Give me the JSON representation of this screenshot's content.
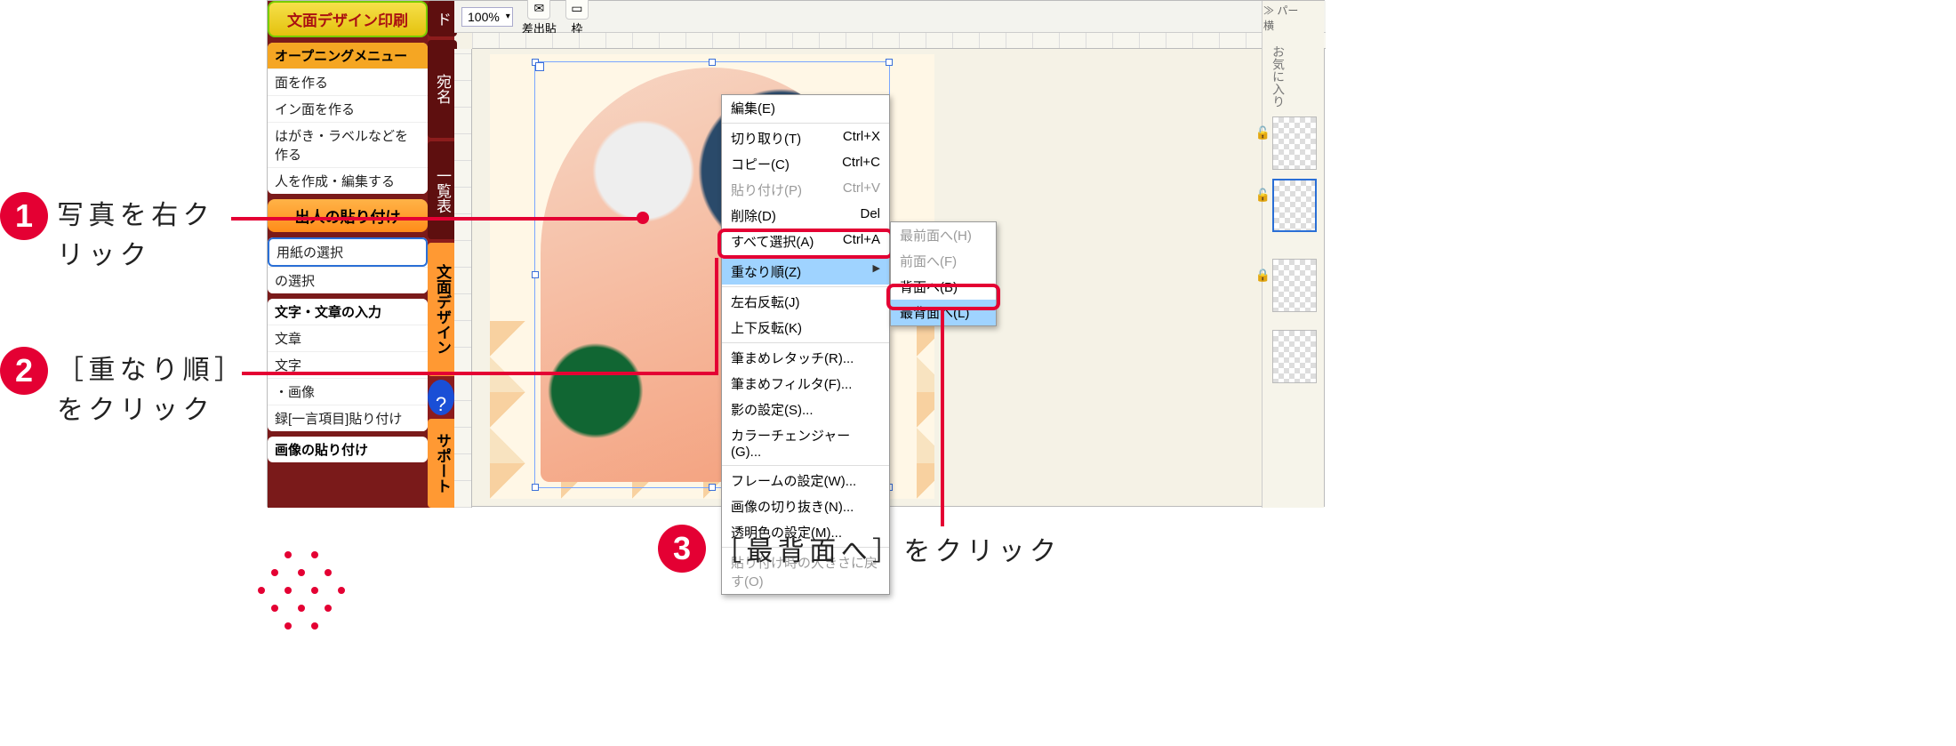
{
  "sidebar": {
    "top_button": "文面デザイン印刷",
    "opening_menu": "オープニングメニュー",
    "opening_items": [
      "面を作る",
      "イン面を作る",
      "はがき・ラベルなどを作る",
      "人を作成・編集する"
    ],
    "section_paste": "出人の貼り付け",
    "paste_items": [
      "用紙の選択",
      "の選択"
    ],
    "section_text": "文字・文章の入力",
    "text_items": [
      "文章",
      "文字",
      "・画像",
      "録[一言項目]貼り付け"
    ],
    "section_image": "画像の貼り付け"
  },
  "vtabs": {
    "t1": "ド",
    "t2": "宛名",
    "t3": "一覧表",
    "t4": "文面デザイン",
    "help": "?",
    "t5": "サポート"
  },
  "toolbar": {
    "zoom": "100%",
    "tool_paste": "差出貼",
    "tool_frame": "枠"
  },
  "context_menu": {
    "edit": "編集(E)",
    "cut": "切り取り(T)",
    "cut_sc": "Ctrl+X",
    "copy": "コピー(C)",
    "copy_sc": "Ctrl+C",
    "paste": "貼り付け(P)",
    "paste_sc": "Ctrl+V",
    "delete": "削除(D)",
    "delete_sc": "Del",
    "selectall": "すべて選択(A)",
    "selectall_sc": "Ctrl+A",
    "order": "重なり順(Z)",
    "fliph": "左右反転(J)",
    "flipv": "上下反転(K)",
    "retouch": "筆まめレタッチ(R)...",
    "filter": "筆まめフィルタ(F)...",
    "shadow": "影の設定(S)...",
    "colorch": "カラーチェンジャー(G)...",
    "frameset": "フレームの設定(W)...",
    "crop": "画像の切り抜き(N)...",
    "transp": "透明色の設定(M)...",
    "resetsize": "貼り付け時の大きさに戻す(O)"
  },
  "submenu": {
    "front": "最前面へ(H)",
    "forward": "前面へ(F)",
    "backward": "背面へ(B)",
    "back": "最背面へ(L)"
  },
  "rpanel": {
    "header": "≫ パー",
    "fav": "お気に入り",
    "row": "横"
  },
  "ann": {
    "n1": "1",
    "t1a": "写真を右ク",
    "t1b": "リック",
    "n2": "2",
    "t2a": "［重なり順］",
    "t2b": "をクリック",
    "n3": "3",
    "t3": "［最背面へ］をクリック"
  }
}
